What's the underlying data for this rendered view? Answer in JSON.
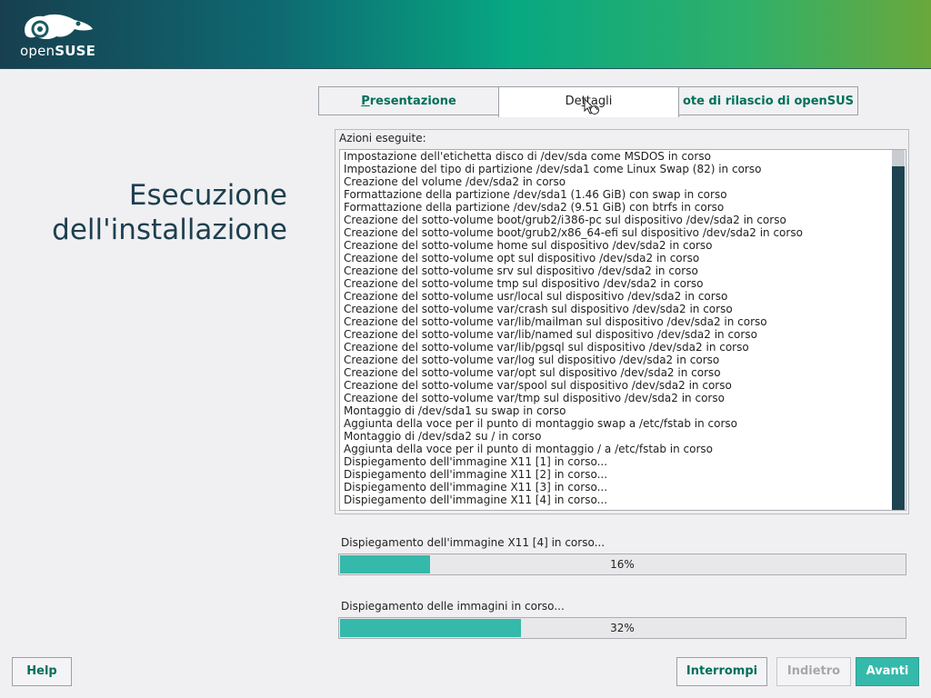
{
  "brand": {
    "logo_light": "open",
    "logo_bold": "SUSE"
  },
  "page": {
    "title": "Esecuzione\ndell'installazione"
  },
  "tabs": [
    {
      "label": "Presentazione",
      "mnemonic": "P"
    },
    {
      "label": "Dettagli",
      "mnemonic": "t"
    },
    {
      "label": "ote di rilascio di openSUS"
    }
  ],
  "actions": {
    "label": "Azioni eseguite:",
    "lines": [
      "Impostazione dell'etichetta disco di /dev/sda come MSDOS in corso",
      "Impostazione del tipo di partizione /dev/sda1 come Linux Swap (82) in corso",
      "Creazione del volume /dev/sda2 in corso",
      "Formattazione della partizione /dev/sda1 (1.46 GiB) con swap in corso",
      "Formattazione della partizione /dev/sda2 (9.51 GiB) con btrfs in corso",
      "Creazione del sotto-volume boot/grub2/i386-pc sul dispositivo /dev/sda2 in corso",
      "Creazione del sotto-volume boot/grub2/x86_64-efi sul dispositivo /dev/sda2 in corso",
      "Creazione del sotto-volume home sul dispositivo /dev/sda2 in corso",
      "Creazione del sotto-volume opt sul dispositivo /dev/sda2 in corso",
      "Creazione del sotto-volume srv sul dispositivo /dev/sda2 in corso",
      "Creazione del sotto-volume tmp sul dispositivo /dev/sda2 in corso",
      "Creazione del sotto-volume usr/local sul dispositivo /dev/sda2 in corso",
      "Creazione del sotto-volume var/crash sul dispositivo /dev/sda2 in corso",
      "Creazione del sotto-volume var/lib/mailman sul dispositivo /dev/sda2 in corso",
      "Creazione del sotto-volume var/lib/named sul dispositivo /dev/sda2 in corso",
      "Creazione del sotto-volume var/lib/pgsql sul dispositivo /dev/sda2 in corso",
      "Creazione del sotto-volume var/log sul dispositivo /dev/sda2 in corso",
      "Creazione del sotto-volume var/opt sul dispositivo /dev/sda2 in corso",
      "Creazione del sotto-volume var/spool sul dispositivo /dev/sda2 in corso",
      "Creazione del sotto-volume var/tmp sul dispositivo /dev/sda2 in corso",
      "Montaggio di /dev/sda1 su swap in corso",
      "Aggiunta della voce per il punto di montaggio swap a /etc/fstab in corso",
      "Montaggio di /dev/sda2 su / in corso",
      "Aggiunta della voce per il punto di montaggio / a /etc/fstab in corso",
      "Dispiegamento dell'immagine X11 [1] in corso...",
      "Dispiegamento dell'immagine X11 [2] in corso...",
      "Dispiegamento dell'immagine X11 [3] in corso...",
      "Dispiegamento dell'immagine X11 [4] in corso..."
    ]
  },
  "progress": [
    {
      "label": "Dispiegamento dell'immagine X11 [4] in corso...",
      "percent": 16,
      "text": "16%"
    },
    {
      "label": "Dispiegamento delle immagini in corso...",
      "percent": 32,
      "text": "32%"
    }
  ],
  "buttons": {
    "help": "Help",
    "abort": "Interrompi",
    "back": "Indietro",
    "next": "Avanti"
  },
  "colors": {
    "accent": "#35b9ab",
    "link": "#00705b",
    "title": "#1d3f4f"
  },
  "icons": {
    "logo": "opensuse-chameleon-icon",
    "cursor": "busy-cursor-icon"
  }
}
